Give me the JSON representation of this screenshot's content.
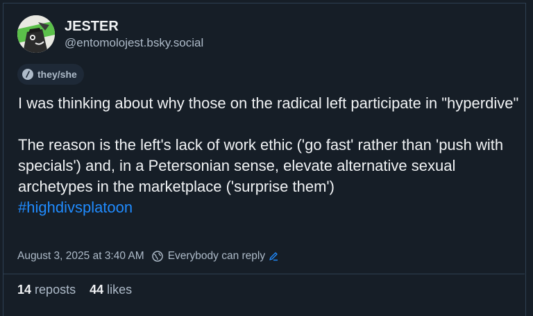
{
  "author": {
    "display_name": "JESTER",
    "handle": "@entomolojest.bsky.social",
    "pronouns": "they/she"
  },
  "post": {
    "paragraph1": "I was thinking about why those on the radical left participate in \"hyperdive\"",
    "paragraph2": "The reason is the left's lack of work ethic ('go fast' rather than 'push with specials') and, in a Petersonian sense, elevate alternative sexual archetypes in the marketplace ('surprise them')",
    "hashtag": "#highdivsplatoon"
  },
  "meta": {
    "timestamp": "August 3, 2025 at 3:40 AM",
    "reply_setting": "Everybody can reply"
  },
  "stats": {
    "reposts_count": "14",
    "reposts_label": "reposts",
    "likes_count": "44",
    "likes_label": "likes"
  },
  "colors": {
    "background": "#161e27",
    "text": "#f1f3f5",
    "muted": "#aebbc9",
    "link": "#208bfe",
    "border": "#2e4052"
  }
}
